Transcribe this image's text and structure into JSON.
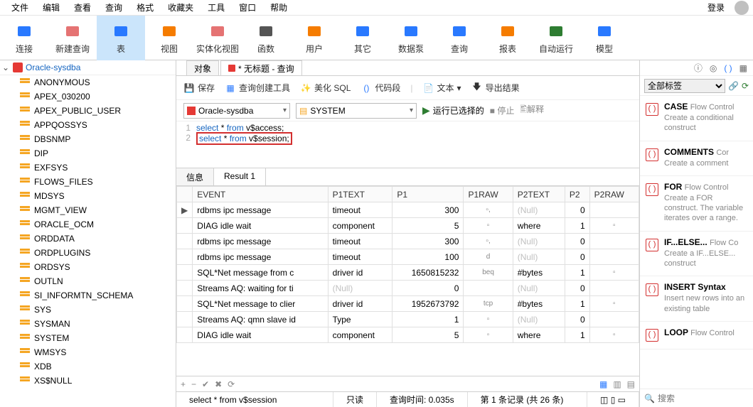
{
  "menu": [
    "文件",
    "编辑",
    "查看",
    "查询",
    "格式",
    "收藏夹",
    "工具",
    "窗口",
    "帮助"
  ],
  "login_label": "登录",
  "toolbar": [
    {
      "id": "connect",
      "label": "连接",
      "color": "#2979ff"
    },
    {
      "id": "new-query",
      "label": "新建查询",
      "color": "#e57373"
    },
    {
      "id": "table",
      "label": "表",
      "color": "#2979ff",
      "active": true
    },
    {
      "id": "view",
      "label": "视图",
      "color": "#f57c00"
    },
    {
      "id": "mview",
      "label": "实体化视图",
      "color": "#e57373"
    },
    {
      "id": "function",
      "label": "函数",
      "color": "#555"
    },
    {
      "id": "user",
      "label": "用户",
      "color": "#f57c00"
    },
    {
      "id": "other",
      "label": "其它",
      "color": "#2979ff"
    },
    {
      "id": "datapump",
      "label": "数据泵",
      "color": "#2979ff"
    },
    {
      "id": "query",
      "label": "查询",
      "color": "#2979ff"
    },
    {
      "id": "report",
      "label": "报表",
      "color": "#f57c00"
    },
    {
      "id": "autorun",
      "label": "自动运行",
      "color": "#2e7d32"
    },
    {
      "id": "model",
      "label": "模型",
      "color": "#2979ff"
    }
  ],
  "connection": {
    "name": "Oracle-sysdba"
  },
  "schemas": [
    "ANONYMOUS",
    "APEX_030200",
    "APEX_PUBLIC_USER",
    "APPQOSSYS",
    "DBSNMP",
    "DIP",
    "EXFSYS",
    "FLOWS_FILES",
    "MDSYS",
    "MGMT_VIEW",
    "ORACLE_OCM",
    "ORDDATA",
    "ORDPLUGINS",
    "ORDSYS",
    "OUTLN",
    "SI_INFORMTN_SCHEMA",
    "SYS",
    "SYSMAN",
    "SYSTEM",
    "WMSYS",
    "XDB",
    "XS$NULL"
  ],
  "doc_tabs": {
    "t1": "对象",
    "t2": "* 无标题 - 查询"
  },
  "qtoolbar": {
    "save": "保存",
    "builder": "查询创建工具",
    "beautify": "美化 SQL",
    "snippet": "代码段",
    "text": "文本",
    "export": "导出结果"
  },
  "selrow": {
    "conn": "Oracle-sysdba",
    "schema": "SYSTEM",
    "run": "运行已选择的",
    "stop": "停止",
    "explain": "解释"
  },
  "editor": {
    "l1_a": "select",
    "l1_b": " * ",
    "l1_c": "from",
    "l1_d": " v$access;",
    "l2_a": "select",
    "l2_b": " * ",
    "l2_c": "from",
    "l2_d": " v$session;"
  },
  "result_tabs": {
    "t1": "信息",
    "t2": "Result 1"
  },
  "grid": {
    "cols": [
      "EVENT",
      "P1TEXT",
      "P1",
      "P1RAW",
      "P2TEXT",
      "P2",
      "P2RAW"
    ],
    "rows": [
      {
        "ptr": "▶",
        "event": "rdbms ipc message",
        "p1t": "timeout",
        "p1": "300",
        "p1r": "▫,",
        "p2t": "(Null)",
        "p2": "0",
        "p2r": ""
      },
      {
        "ptr": "",
        "event": "DIAG idle wait",
        "p1t": "component",
        "p1": "5",
        "p1r": "▫",
        "p2t": "where",
        "p2": "1",
        "p2r": "▫"
      },
      {
        "ptr": "",
        "event": "rdbms ipc message",
        "p1t": "timeout",
        "p1": "300",
        "p1r": "▫,",
        "p2t": "(Null)",
        "p2": "0",
        "p2r": ""
      },
      {
        "ptr": "",
        "event": "rdbms ipc message",
        "p1t": "timeout",
        "p1": "100",
        "p1r": "d",
        "p2t": "(Null)",
        "p2": "0",
        "p2r": ""
      },
      {
        "ptr": "",
        "event": "SQL*Net message from c",
        "p1t": "driver id",
        "p1": "1650815232",
        "p1r": "beq",
        "p2t": "#bytes",
        "p2": "1",
        "p2r": "▫"
      },
      {
        "ptr": "",
        "event": "Streams AQ: waiting for ti",
        "p1t": "(Null)",
        "p1": "0",
        "p1r": "",
        "p2t": "(Null)",
        "p2": "0",
        "p2r": ""
      },
      {
        "ptr": "",
        "event": "SQL*Net message to clier",
        "p1t": "driver id",
        "p1": "1952673792",
        "p1r": "tcp",
        "p2t": "#bytes",
        "p2": "1",
        "p2r": "▫"
      },
      {
        "ptr": "",
        "event": "Streams AQ: qmn slave id",
        "p1t": "Type",
        "p1": "1",
        "p1r": "▫",
        "p2t": "(Null)",
        "p2": "0",
        "p2r": ""
      },
      {
        "ptr": "",
        "event": "DIAG idle wait",
        "p1t": "component",
        "p1": "5",
        "p1r": "▫",
        "p2t": "where",
        "p2": "1",
        "p2r": "▫"
      }
    ]
  },
  "status": {
    "sql": "select * from v$session",
    "ro": "只读",
    "time": "查询时间: 0.035s",
    "rows": "第 1 条记录 (共 26 条)"
  },
  "right": {
    "filter": "全部标签",
    "snippets": [
      {
        "title": "CASE",
        "sub": "Flow Control",
        "desc": "Create a conditional construct"
      },
      {
        "title": "COMMENTS",
        "sub": "Cor",
        "desc": "Create a comment"
      },
      {
        "title": "FOR",
        "sub": "Flow Control",
        "desc": "Create a FOR construct. The variable iterates over a range."
      },
      {
        "title": "IF...ELSE...",
        "sub": "Flow Co",
        "desc": "Create a IF...ELSE... construct"
      },
      {
        "title": "INSERT Syntax",
        "sub": "",
        "desc": "Insert new rows into an existing table"
      },
      {
        "title": "LOOP",
        "sub": "Flow Control",
        "desc": ""
      }
    ],
    "search_ph": "搜索"
  }
}
